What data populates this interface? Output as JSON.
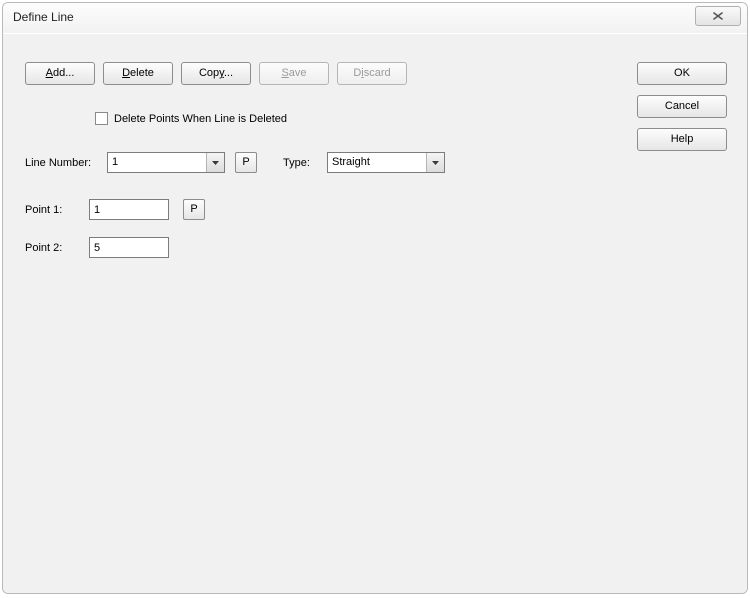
{
  "titlebar": {
    "title": "Define Line"
  },
  "toolbar": {
    "add": "Add...",
    "delete": "Delete",
    "copy": "Copy...",
    "save": "Save",
    "discard": "Discard"
  },
  "checkbox": {
    "label": "Delete Points When Line is Deleted",
    "checked": false
  },
  "line_number": {
    "label": "Line Number:",
    "value": "1",
    "p_button": "P"
  },
  "type": {
    "label": "Type:",
    "value": "Straight"
  },
  "point1": {
    "label": "Point 1:",
    "value": "1",
    "p_button": "P"
  },
  "point2": {
    "label": "Point 2:",
    "value": "5"
  },
  "side": {
    "ok": "OK",
    "cancel": "Cancel",
    "help": "Help"
  }
}
